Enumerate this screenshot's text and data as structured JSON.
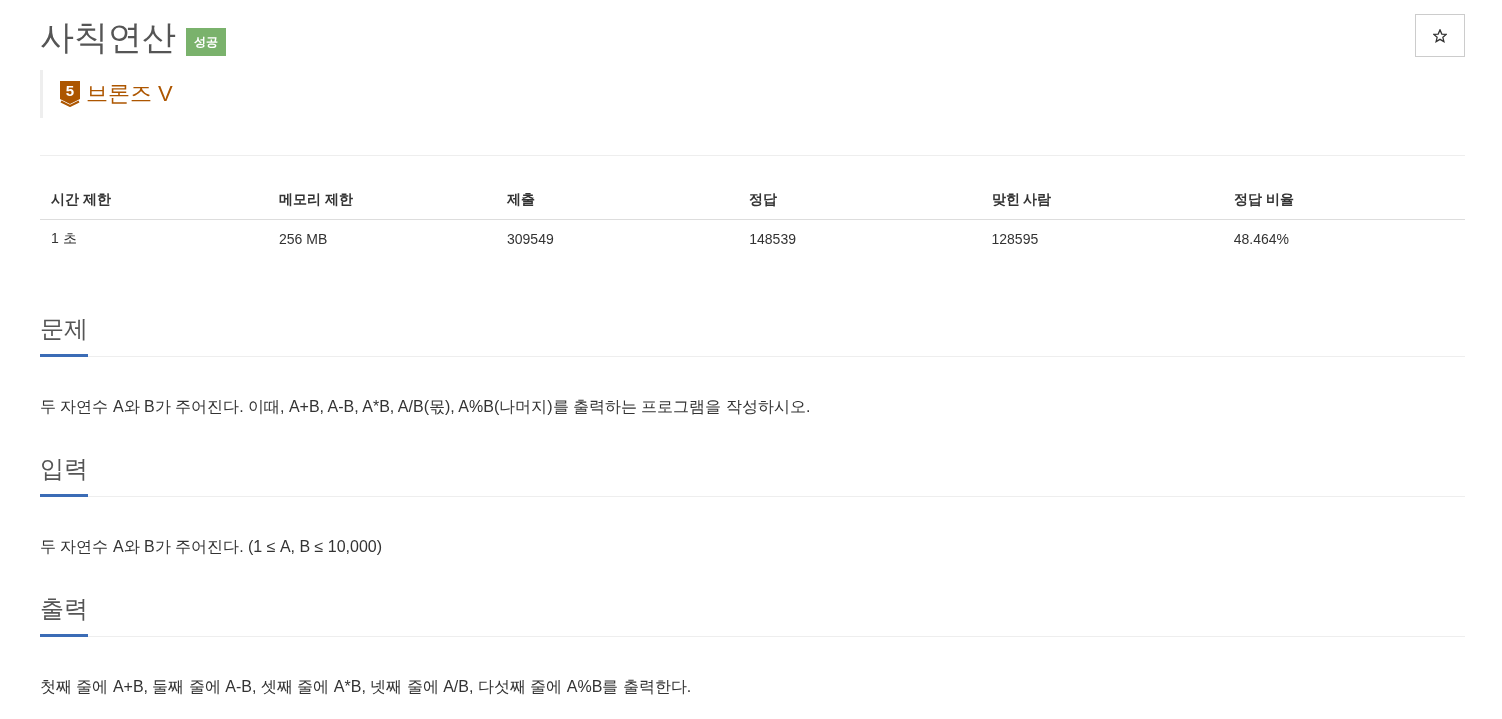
{
  "problem": {
    "title": "사칙연산",
    "result_badge": {
      "label": "성공",
      "kind": "success"
    },
    "favorite": {
      "starred": false
    }
  },
  "tier": {
    "number": "5",
    "label": "브론즈 V",
    "kind": "bronze"
  },
  "stats": {
    "columns": [
      "시간 제한",
      "메모리 제한",
      "제출",
      "정답",
      "맞힌 사람",
      "정답 비율"
    ],
    "rows": [
      [
        "1 초",
        "256 MB",
        "309549",
        "148539",
        "128595",
        "48.464%"
      ]
    ]
  },
  "sections": [
    {
      "heading": "문제",
      "text": "두 자연수 A와 B가 주어진다. 이때, A+B, A-B, A*B, A/B(몫), A%B(나머지)를 출력하는 프로그램을 작성하시오."
    },
    {
      "heading": "입력",
      "text": "두 자연수 A와 B가 주어진다. (1 ≤ A, B ≤ 10,000)"
    },
    {
      "heading": "출력",
      "text": "첫째 줄에 A+B, 둘째 줄에 A-B, 셋째 줄에 A*B, 넷째 줄에 A/B, 다섯째 줄에 A%B를 출력한다."
    }
  ]
}
